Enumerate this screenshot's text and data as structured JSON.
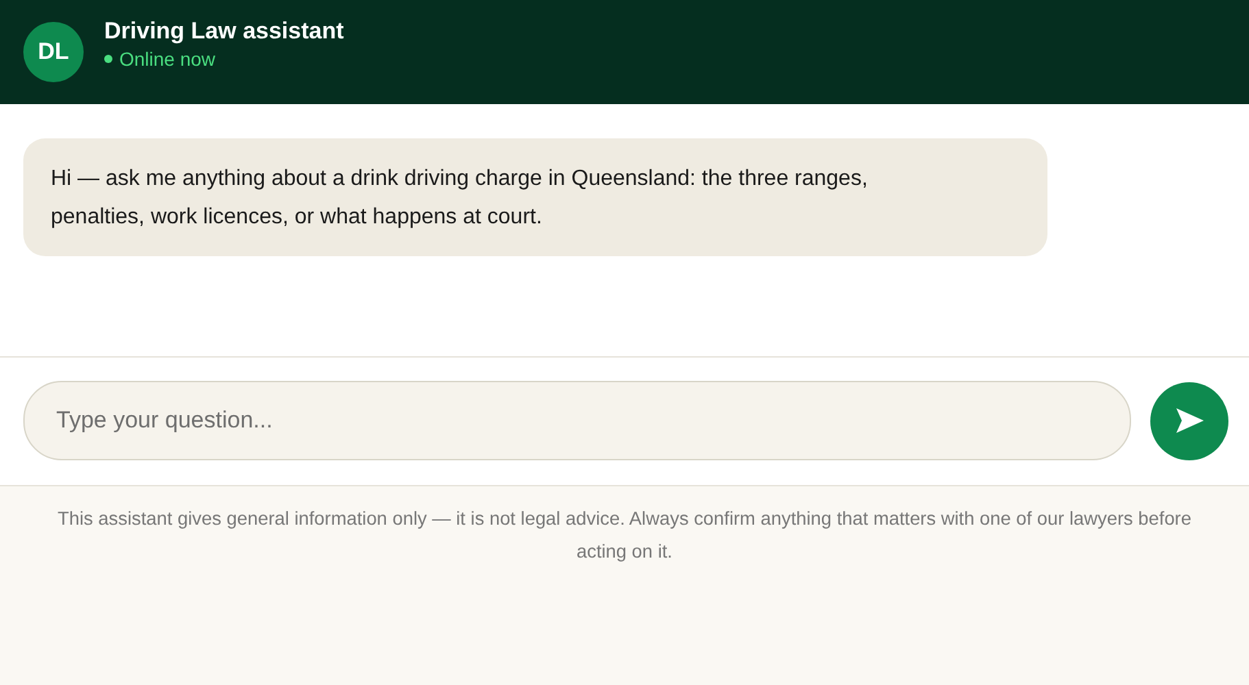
{
  "header": {
    "avatar": "DL",
    "title": "Driving Law assistant",
    "status": "Online now"
  },
  "messages": [
    {
      "kind": "incoming",
      "text": "Hi — ask me anything about a drink driving charge in Queensland: the three ranges, penalties, work licences, or what happens at court."
    }
  ],
  "composer": {
    "placeholder": "Type your question..."
  },
  "disclaimer": "This assistant gives general information only — it is not legal advice. Always confirm anything that matters with one of our lawyers before acting on it."
}
